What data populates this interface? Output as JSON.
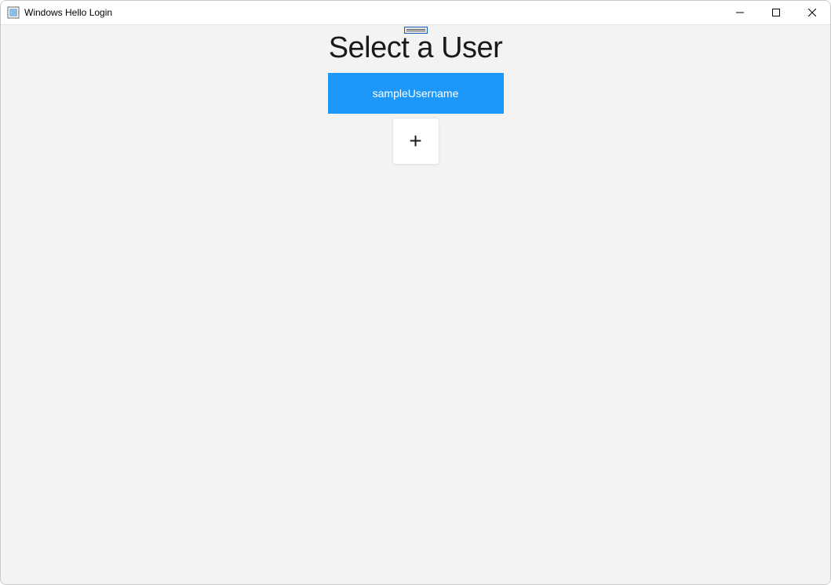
{
  "window": {
    "title": "Windows Hello Login"
  },
  "main": {
    "heading": "Select a User",
    "users": [
      {
        "label": "sampleUsername"
      }
    ],
    "add_label": "+"
  },
  "colors": {
    "accent": "#1e98f8",
    "content_bg": "#f3f3f3"
  }
}
